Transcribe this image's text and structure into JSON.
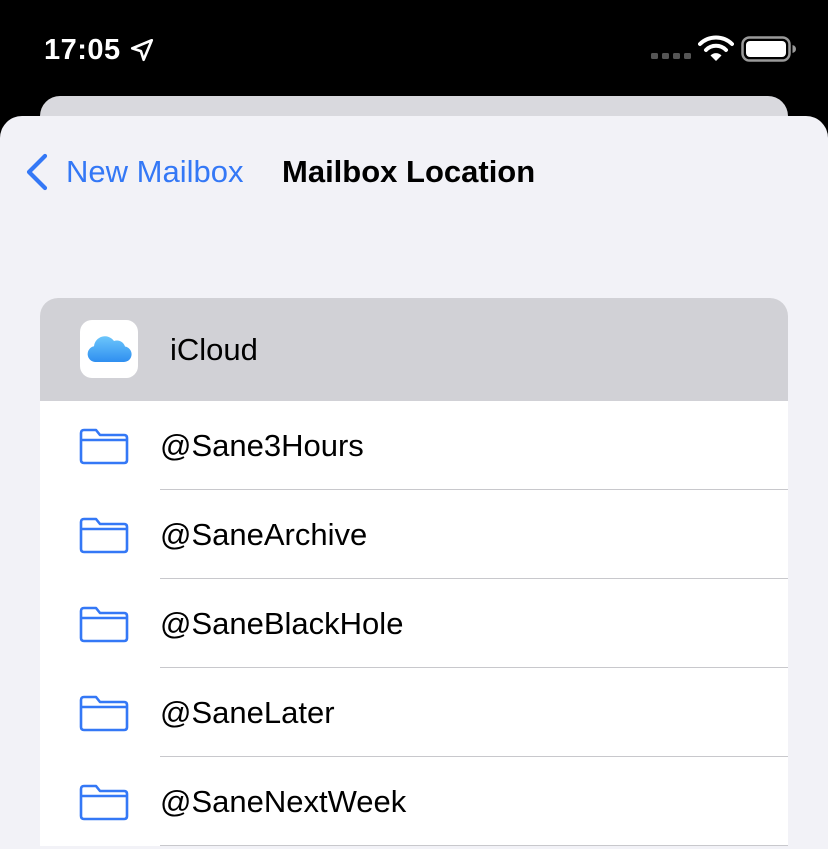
{
  "status_bar": {
    "time": "17:05"
  },
  "nav": {
    "back_label": "New Mailbox",
    "title": "Mailbox Location"
  },
  "account": {
    "label": "iCloud"
  },
  "folders": [
    {
      "label": "@Sane3Hours"
    },
    {
      "label": "@SaneArchive"
    },
    {
      "label": "@SaneBlackHole"
    },
    {
      "label": "@SaneLater"
    },
    {
      "label": "@SaneNextWeek"
    }
  ],
  "icons": {
    "location": "location-arrow-icon",
    "signal": "cellular-signal-icon",
    "wifi": "wifi-icon",
    "battery": "battery-icon",
    "back": "chevron-left-icon",
    "account": "icloud-icon",
    "folder": "folder-icon"
  },
  "colors": {
    "accent": "#3478f6",
    "sheet_background": "#f2f2f7",
    "selected_row": "#d1d1d6",
    "status_bar_background": "#000000"
  }
}
